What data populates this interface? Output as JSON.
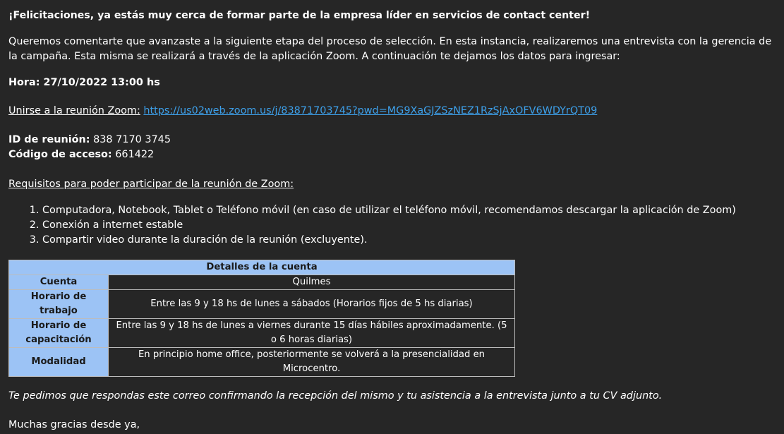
{
  "email": {
    "heading": "¡Felicitaciones, ya estás muy cerca de formar parte de la empresa líder en servicios de contact center!",
    "intro": "Queremos comentarte que avanzaste a la siguiente etapa del proceso de selección. En esta instancia, realizaremos una entrevista con la gerencia de la campaña. Esta misma se realizará a través de la aplicación Zoom. A continuación te dejamos los datos para ingresar:",
    "hora": "Hora: 27/10/2022  13:00 hs",
    "zoom_label": "Unirse a la reunión Zoom:",
    "zoom_link": "https://us02web.zoom.us/j/83871703745?pwd=MG9XaGJZSzNEZ1RzSjAxOFV6WDYrQT09",
    "meeting_id_label": "ID de reunión:",
    "meeting_id_value": " 838 7170 3745",
    "access_code_label": "Código de acceso:",
    "access_code_value": " 661422",
    "requirements_title": "Requisitos para poder participar de la reunión de Zoom:",
    "requirements": [
      "Computadora, Notebook, Tablet o Teléfono móvil (en caso de utilizar el teléfono móvil, recomendamos descargar la aplicación de Zoom)",
      "Conexión a internet estable",
      "Compartir video durante la duración de la reunión (excluyente)."
    ],
    "table": {
      "title": "Detalles de la cuenta",
      "rows": [
        {
          "label": "Cuenta",
          "value": "Quilmes"
        },
        {
          "label": "Horario de trabajo",
          "value": "Entre las 9 y 18 hs de lunes a sábados (Horarios fijos de 5 hs diarias)"
        },
        {
          "label": "Horario de capacitación",
          "value": "Entre las 9 y 18 hs de lunes a viernes durante 15 días hábiles aproximadamente. (5 o 6 horas diarias)"
        },
        {
          "label": "Modalidad",
          "value": "En principio home office, posteriormente se volverá a la presencialidad en Microcentro."
        }
      ]
    },
    "closing": "Te pedimos que respondas este correo confirmando la recepción del mismo y tu asistencia a la entrevista junto a tu CV adjunto.",
    "thanks": "Muchas gracias desde ya,"
  },
  "colors": {
    "background": "#262626",
    "text": "#ffffff",
    "link": "#3da0ea",
    "table_header": "#9cc3f5"
  }
}
